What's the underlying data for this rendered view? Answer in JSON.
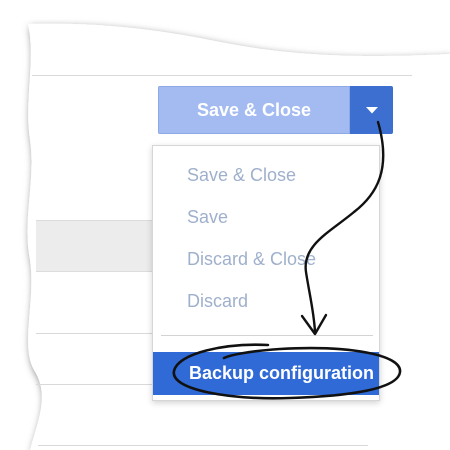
{
  "toolbar": {
    "save_close_label": "Save & Close",
    "dropdown_icon": "caret-down-icon",
    "primary_color": "#a3bbf0",
    "toggle_color": "#3d6fd1"
  },
  "menu": {
    "items": [
      {
        "label": "Save & Close"
      },
      {
        "label": "Save"
      },
      {
        "label": "Discard & Close"
      },
      {
        "label": "Discard"
      }
    ],
    "highlighted": {
      "label": "Backup configuration"
    },
    "highlight_color": "#2f6ad6",
    "item_text_color": "#9fb0cc"
  },
  "annotation": {
    "arrow_icon": "hand-drawn-arrow-icon",
    "ellipse_icon": "hand-drawn-ellipse-icon"
  }
}
